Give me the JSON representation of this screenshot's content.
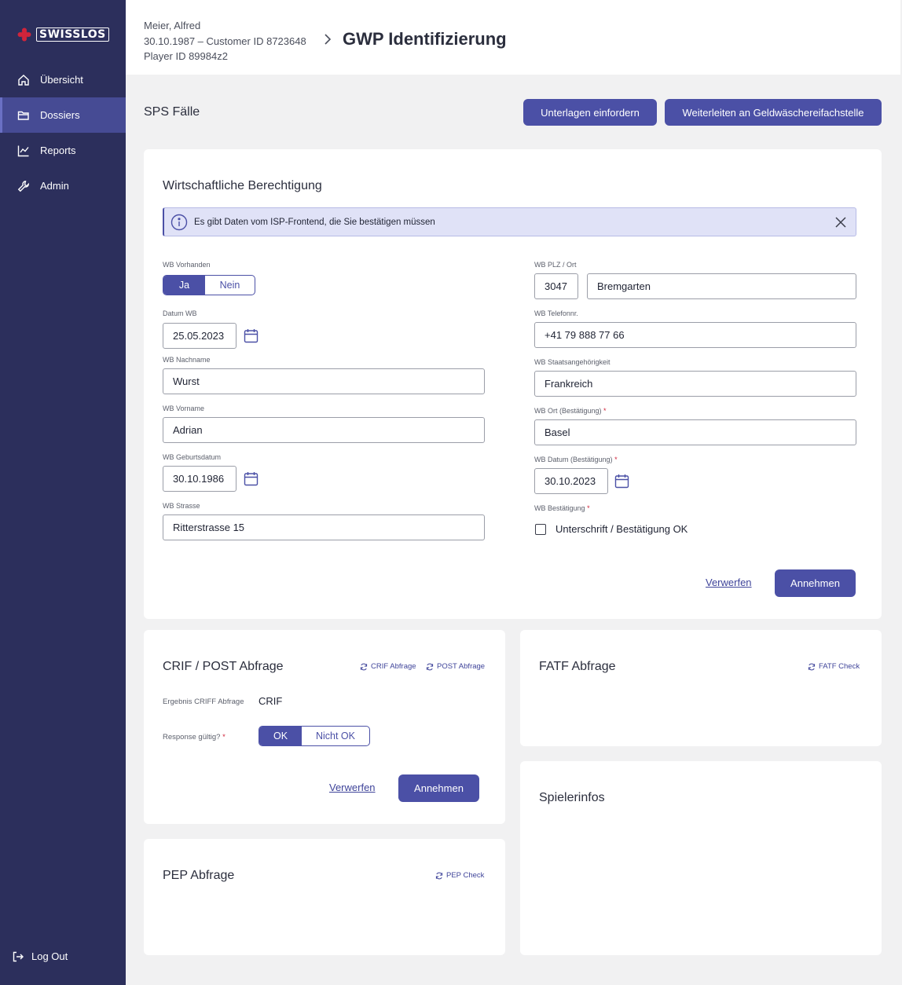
{
  "brand": {
    "name": "SWISSLOS",
    "color": "#d0243b"
  },
  "sidebar": {
    "items": [
      {
        "label": "Übersicht",
        "icon": "home-icon"
      },
      {
        "label": "Dossiers",
        "icon": "folder-icon",
        "active": true
      },
      {
        "label": "Reports",
        "icon": "chart-icon"
      },
      {
        "label": "Admin",
        "icon": "wrench-icon"
      }
    ],
    "logout": "Log Out"
  },
  "header": {
    "name": "Meier, Alfred",
    "birth_customer": "30.10.1987 – Customer ID 8723648",
    "player_id": "Player ID 89984z2",
    "title": "GWP Identifizierung"
  },
  "section": {
    "title": "SPS Fälle",
    "btn_unterlagen": "Unterlagen einfordern",
    "btn_weiterleiten": "Weiterleiten an Geldwäschereifachstelle"
  },
  "wb": {
    "title": "Wirtschaftliche Berechtigung",
    "alert": "Es gibt Daten vom ISP-Frontend, die Sie bestätigen müssen",
    "vorhanden_label": "WB Vorhanden",
    "vorhanden_yes": "Ja",
    "vorhanden_no": "Nein",
    "datum_label": "Datum WB",
    "datum": "25.05.2023",
    "nachname_label": "WB Nachname",
    "nachname": "Wurst",
    "vorname_label": "WB Vorname",
    "vorname": "Adrian",
    "geburtsdatum_label": "WB Geburtsdatum",
    "geburtsdatum": "30.10.1986",
    "strasse_label": "WB Strasse",
    "strasse": "Ritterstrasse 15",
    "plz_ort_label": "WB PLZ / Ort",
    "plz": "3047",
    "ort": "Bremgarten",
    "telefon_label": "WB Telefonnr.",
    "telefon": "+41 79 888 77 66",
    "staat_label": "WB Staatsangehörigkeit",
    "staat": "Frankreich",
    "ort_best_label": "WB Ort (Bestätigung)",
    "ort_best": "Basel",
    "datum_best_label": "WB Datum (Bestätigung)",
    "datum_best": "30.10.2023",
    "best_label": "WB Bestätigung",
    "best_checkbox": "Unterschrift / Bestätigung OK",
    "required_mark": "*",
    "discard": "Verwerfen",
    "accept": "Annehmen"
  },
  "crif": {
    "title": "CRIF / POST Abfrage",
    "refresh_crif": "CRIF Abfrage",
    "refresh_post": "POST Abfrage",
    "result_label": "Ergebnis CRIFF Abfrage",
    "result_value": "CRIF",
    "response_label": "Response gültig?",
    "ok": "OK",
    "not_ok": "Nicht OK",
    "discard": "Verwerfen",
    "accept": "Annehmen"
  },
  "fatf": {
    "title": "FATF Abfrage",
    "refresh": "FATF Check"
  },
  "pep": {
    "title": "PEP Abfrage",
    "refresh": "PEP Check"
  },
  "spieler": {
    "title": "Spielerinfos"
  },
  "colors": {
    "sidebar": "#2c2f5c",
    "accent": "#4b50a6",
    "alert_bg": "#e0e2f7"
  }
}
